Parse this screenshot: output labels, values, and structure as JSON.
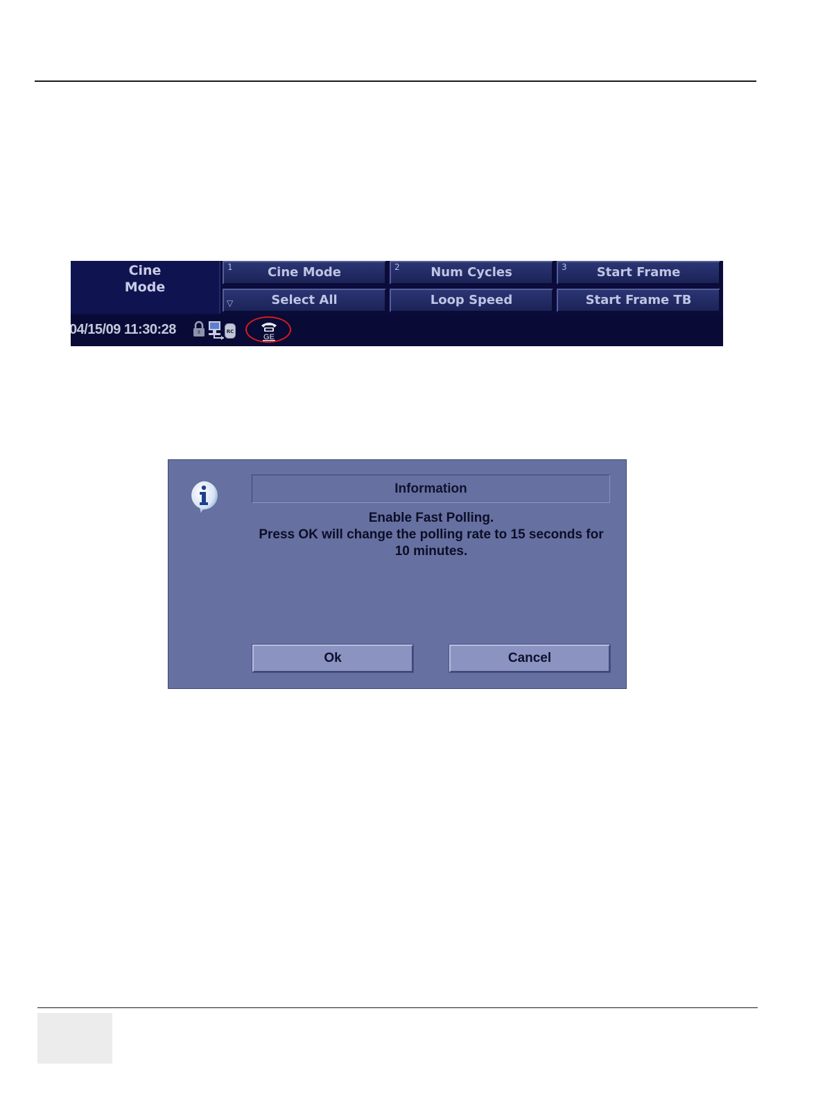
{
  "touch_panel": {
    "mode_title_line1": "Cine",
    "mode_title_line2": "Mode",
    "row1": [
      {
        "num": "1",
        "label": "Cine Mode"
      },
      {
        "num": "2",
        "label": "Num Cycles"
      },
      {
        "num": "3",
        "label": "Start Frame"
      }
    ],
    "row2": [
      {
        "label": "Select All"
      },
      {
        "label": "Loop Speed"
      },
      {
        "label": "Start Frame TB"
      }
    ],
    "status": {
      "datetime": "04/15/09 11:30:28",
      "icons": [
        "lock-icon",
        "network-icon",
        "rc-badge-icon",
        "ge-phone-icon"
      ],
      "ge_label": "GE",
      "rc_label": "RC",
      "highlight_color": "#d61c1c"
    }
  },
  "dialog": {
    "title": "Information",
    "message_line1": "Enable Fast Polling.",
    "message_line2": "Press OK will change the polling rate to 15 seconds for",
    "message_line3": "10 minutes.",
    "ok_label": "Ok",
    "cancel_label": "Cancel",
    "icon": "info-icon"
  }
}
